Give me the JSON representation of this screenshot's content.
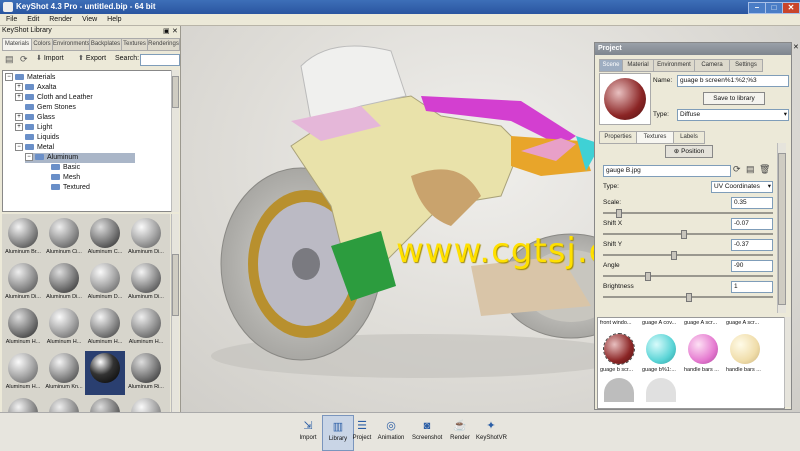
{
  "window": {
    "title": "KeyShot 4.3 Pro  -  untitled.bip  -  64 bit"
  },
  "menu": [
    "File",
    "Edit",
    "Render",
    "View",
    "Help"
  ],
  "library": {
    "title": "KeyShot Library",
    "tabs": [
      "Materials",
      "Colors",
      "Environments",
      "Backplates",
      "Textures",
      "Renderings"
    ],
    "import_label": "Import",
    "export_label": "Export",
    "search_label": "Search:",
    "search_value": "",
    "tree": [
      "Materials",
      "Axalta",
      "Cloth and Leather",
      "Gem Stones",
      "Glass",
      "Light",
      "Liquids",
      "Metal",
      "Aluminum",
      "Basic",
      "Mesh",
      "Textured"
    ],
    "materials": [
      "Aluminum Br...",
      "Aluminum Ci...",
      "Aluminum C...",
      "Aluminum Di...",
      "Aluminum Di...",
      "Aluminum Di...",
      "Aluminum D...",
      "Aluminum Di...",
      "Aluminum H...",
      "Aluminum H...",
      "Aluminum H...",
      "Aluminum H...",
      "Aluminum H...",
      "Aluminum Kn...",
      "",
      "Aluminum Ri...",
      "",
      "",
      "",
      ""
    ]
  },
  "watermark": "www.cgtsj.com",
  "project": {
    "title": "Project",
    "tabs": [
      "Scene",
      "Material",
      "Environment",
      "Camera",
      "Settings"
    ],
    "name_label": "Name:",
    "name_value": "guage b screen%1:%2;%3",
    "save_label": "Save to library",
    "type_label": "Type:",
    "type_value": "Diffuse",
    "subtabs": [
      "Properties",
      "Textures",
      "Labels"
    ],
    "position_label": "Position",
    "texture_file": "gauge B.jpg",
    "mapping_label": "Type:",
    "mapping_value": "UV Coordinates",
    "params": [
      {
        "label": "Scale:",
        "value": "0.35",
        "knob": 0.08
      },
      {
        "label": "Shift X",
        "value": "-0.07",
        "knob": 0.47
      },
      {
        "label": "Shift Y",
        "value": "-0.37",
        "knob": 0.41
      },
      {
        "label": "Angle",
        "value": "-90",
        "knob": 0.25
      },
      {
        "label": "Brightness",
        "value": "1",
        "knob": 0.5
      }
    ],
    "swatch_labels_top": [
      "front windo...",
      "guage A cov...",
      "guage A scr...",
      "guage A scr..."
    ],
    "swatch_labels_bottom": [
      "guage b scr...",
      "guage b%1:...",
      "handle bars ...",
      "handle bars ..."
    ]
  },
  "bottombar": [
    "Import",
    "Library",
    "Project",
    "Animation",
    "Screenshot",
    "Render",
    "KeyShotVR"
  ]
}
